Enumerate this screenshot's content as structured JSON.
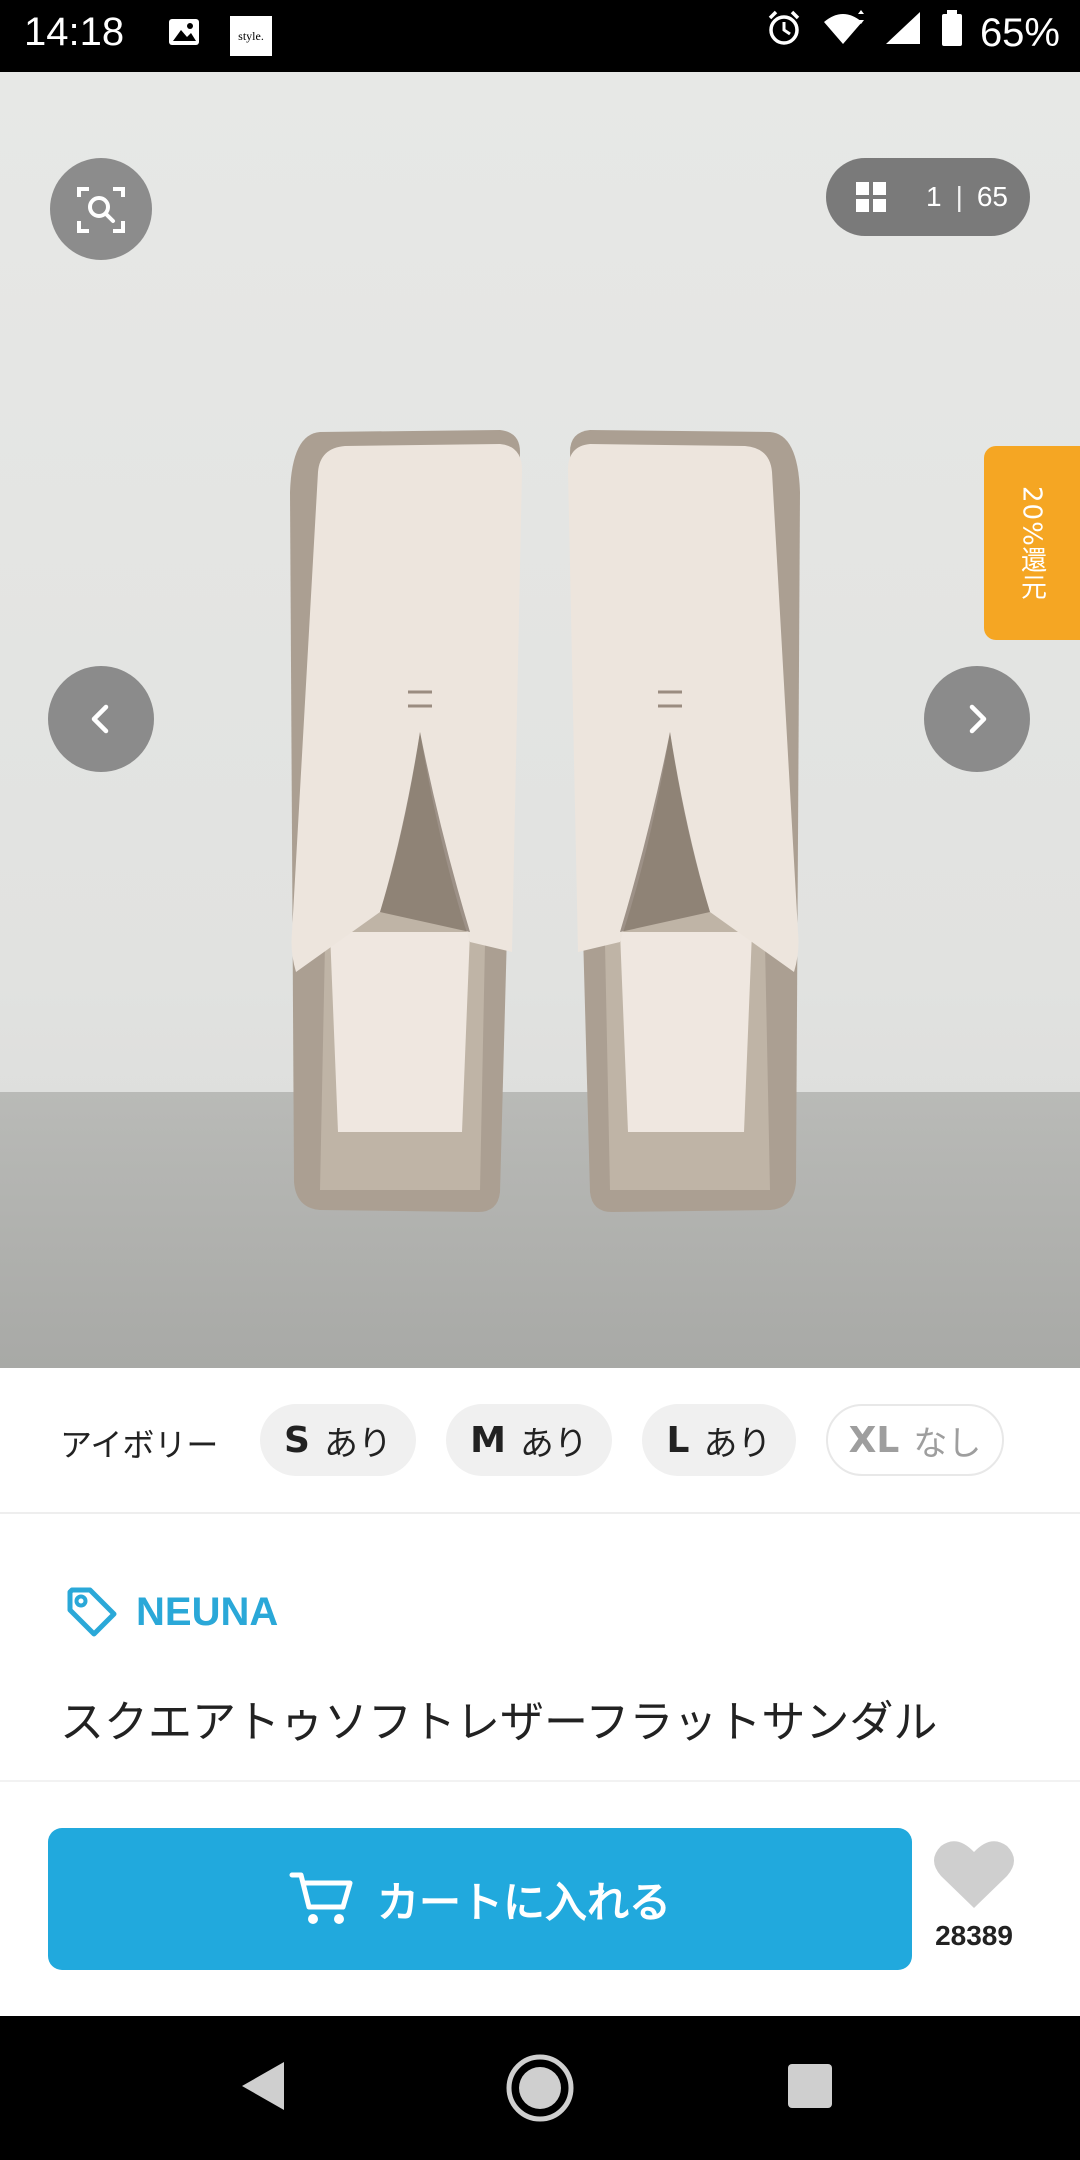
{
  "status_bar": {
    "time": "14:18",
    "battery": "65%",
    "notification_app_label": "style."
  },
  "gallery": {
    "current": "1",
    "total": "65",
    "separator": "|",
    "reward_label": "20%還元",
    "image_description": "ivory square-toe leather flat sandals"
  },
  "variant": {
    "color_name": "アイボリー",
    "sizes": [
      {
        "size": "S",
        "stock": "あり"
      },
      {
        "size": "M",
        "stock": "あり"
      },
      {
        "size": "L",
        "stock": "あり"
      },
      {
        "size": "XL",
        "stock": "なし"
      }
    ]
  },
  "product": {
    "brand": "NEUNA",
    "title": "スクエアトゥソフトレザーフラットサンダル"
  },
  "actions": {
    "cart_label": "カートに入れる",
    "favorite_count": "28389"
  },
  "colors": {
    "accent": "#21a9dd",
    "brand_text": "#2aa8d8",
    "reward": "#f5a623"
  }
}
